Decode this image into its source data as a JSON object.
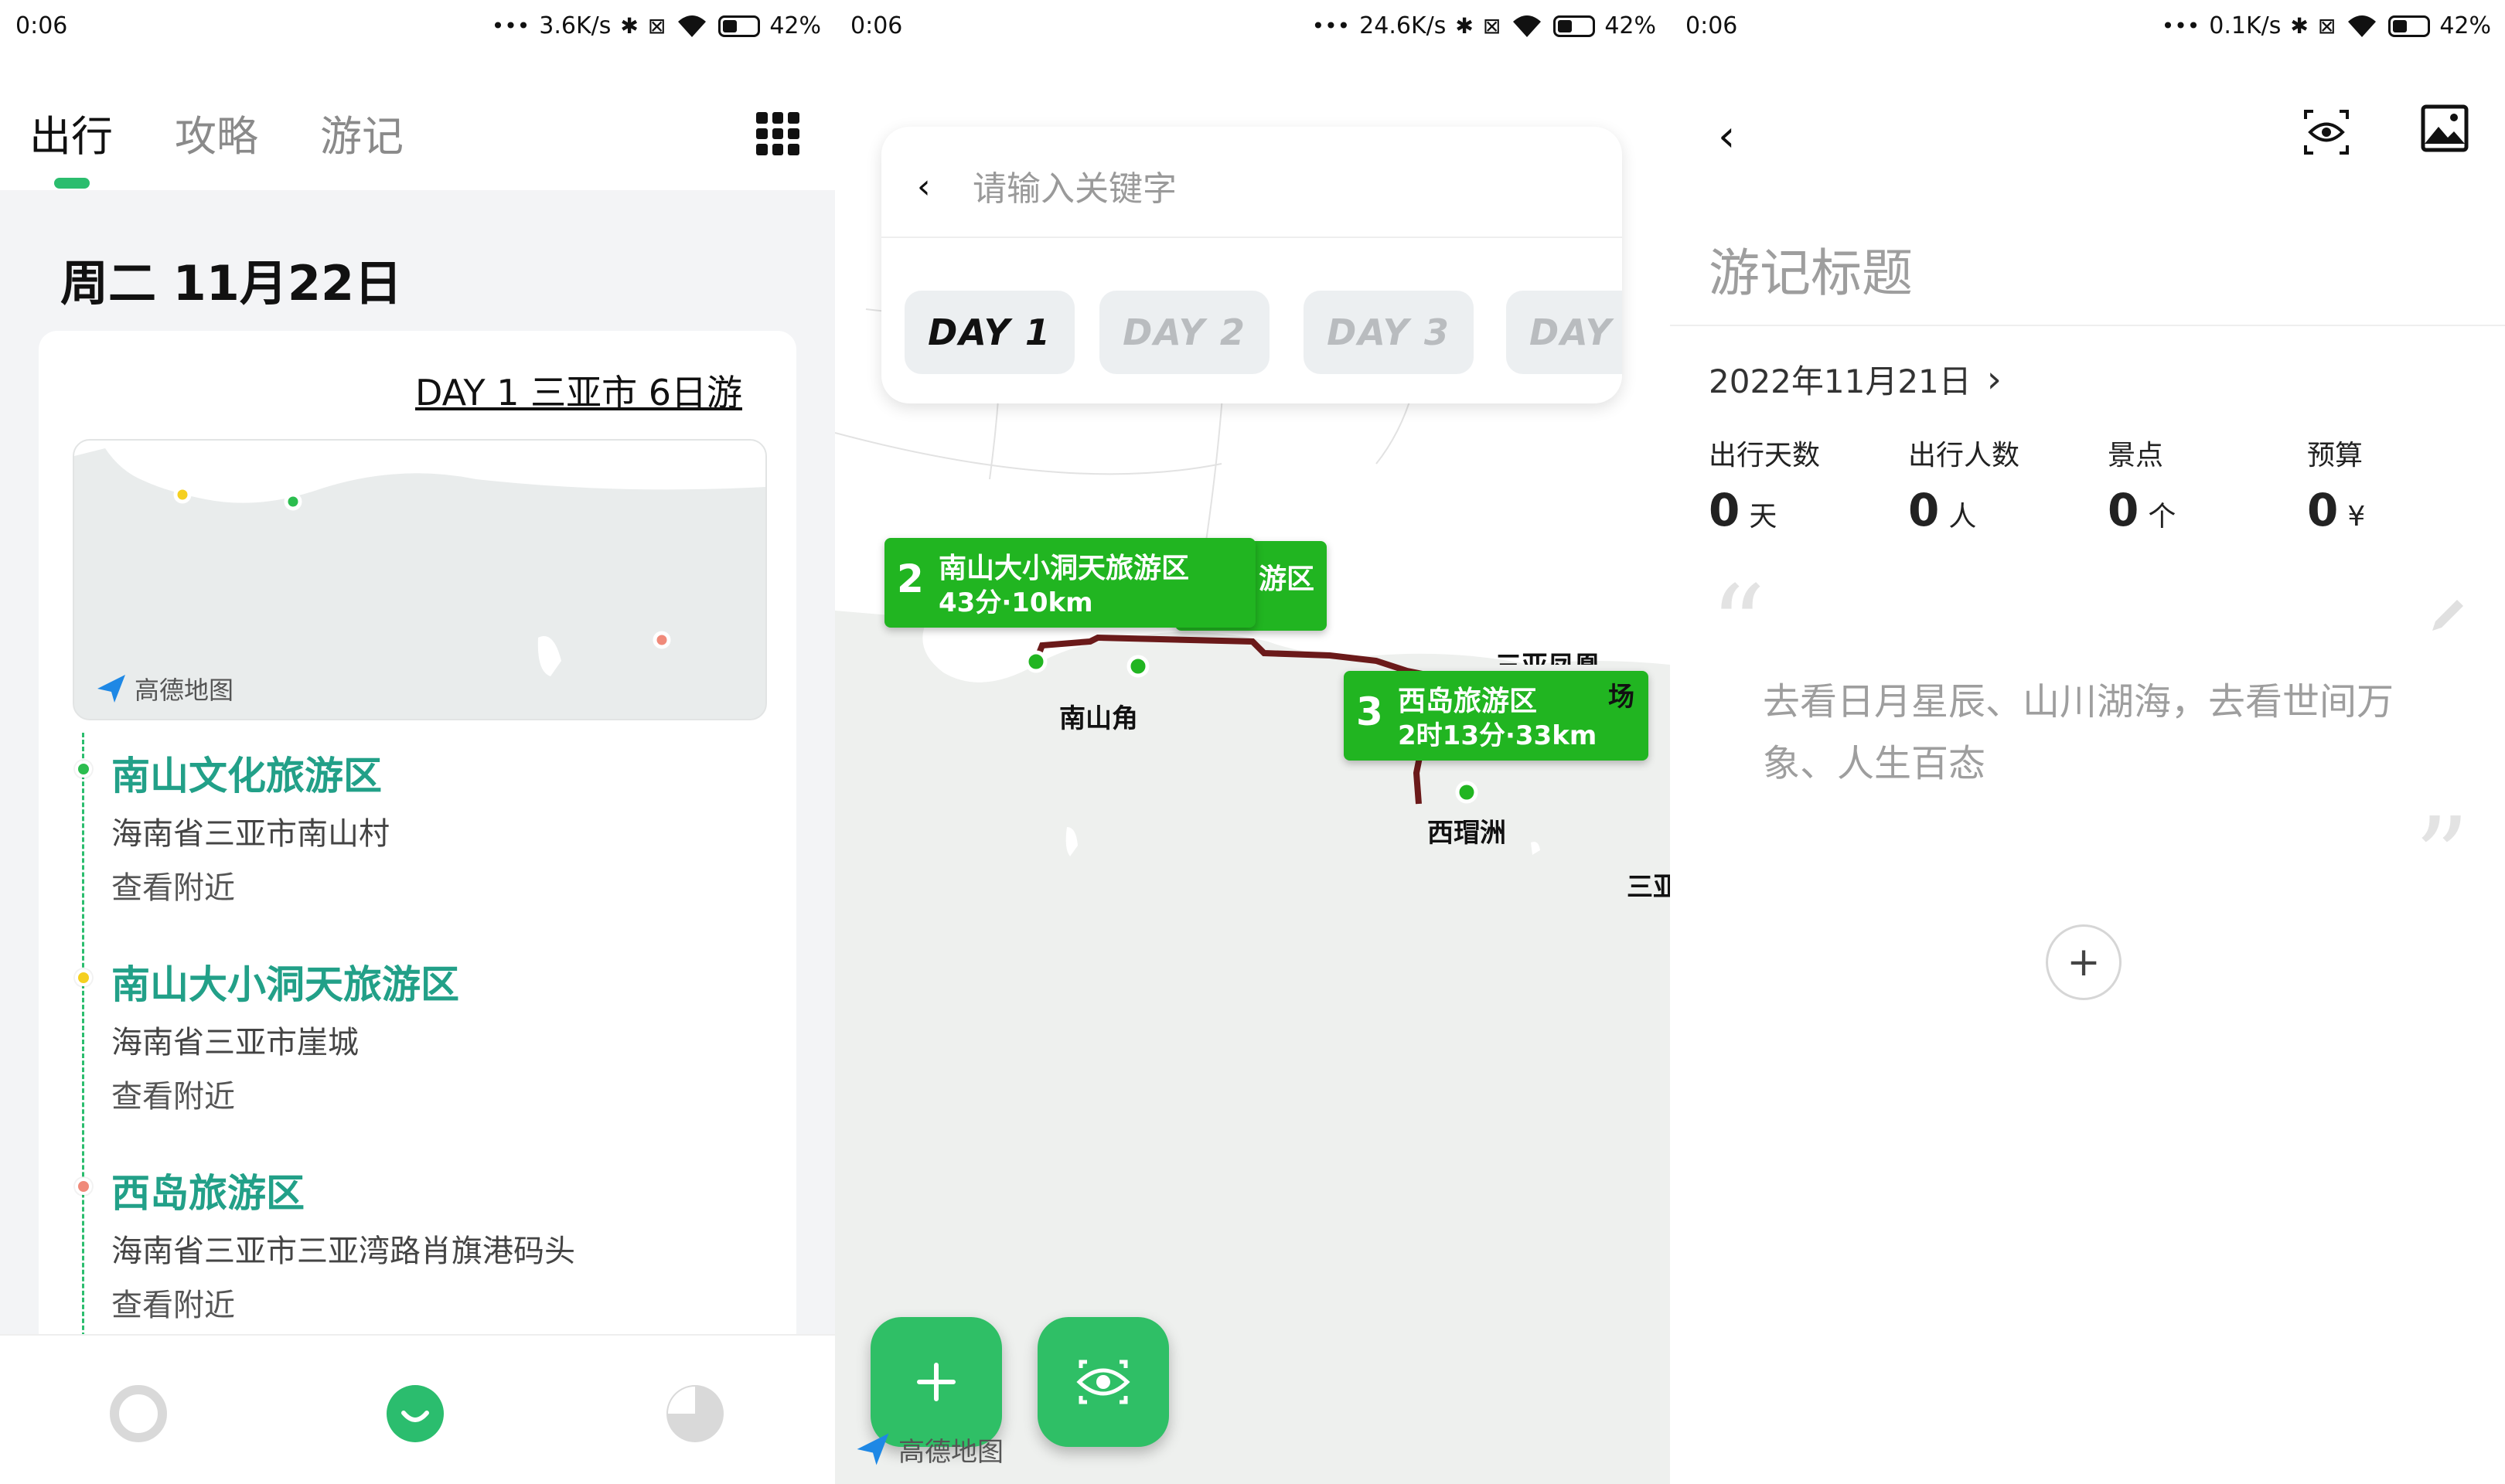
{
  "screens": [
    {
      "status": {
        "time": "0:06",
        "speed": "3.6K/s",
        "battery": "42%"
      },
      "tabs": [
        "出行",
        "攻略",
        "游记"
      ],
      "active_tab": "出行",
      "date_heading": "周二 11月22日",
      "trip_title": "DAY 1 三亚市 6日游",
      "map_brand": "高德地图",
      "stops": [
        {
          "name": "南山文化旅游区",
          "address": "海南省三亚市南山村",
          "action": "查看附近",
          "color": "#2bbd4e"
        },
        {
          "name": "南山大小洞天旅游区",
          "address": "海南省三亚市崖城",
          "action": "查看附近",
          "color": "#f5d020"
        },
        {
          "name": "西岛旅游区",
          "address": "海南省三亚市三亚湾路肖旗港码头",
          "action": "查看附近",
          "color": "#f08a7a"
        }
      ],
      "bottom_nav": [
        {
          "icon": "ring-icon",
          "active": false
        },
        {
          "icon": "smile-icon",
          "active": true
        },
        {
          "icon": "pie-icon",
          "active": false
        }
      ]
    },
    {
      "status": {
        "time": "0:06",
        "speed": "24.6K/s",
        "battery": "42%"
      },
      "search_placeholder": "请输入关键字",
      "days": [
        "DAY 1",
        "DAY 2",
        "DAY 3",
        "DAY"
      ],
      "selected_day": "DAY 1",
      "markers": [
        {
          "num": "2",
          "name": "南山大小洞天旅游区",
          "info": "43分·10km"
        },
        {
          "num": "3",
          "name": "西岛旅游区",
          "info": "2时13分·33km"
        }
      ],
      "hidden_marker_text": "游区",
      "places": [
        "南山角",
        "西瑁洲",
        "三亚凤凰",
        "场",
        "三亚"
      ],
      "map_brand": "高德地图",
      "fabs": [
        "plus-icon",
        "eye-icon"
      ]
    },
    {
      "status": {
        "time": "0:06",
        "speed": "0.1K/s",
        "battery": "42%"
      },
      "title_placeholder": "游记标题",
      "date": "2022年11月21日",
      "stats": [
        {
          "label": "出行天数",
          "value": "0",
          "unit": "天"
        },
        {
          "label": "出行人数",
          "value": "0",
          "unit": "人"
        },
        {
          "label": "景点",
          "value": "0",
          "unit": "个"
        },
        {
          "label": "预算",
          "value": "0",
          "unit": "¥"
        }
      ],
      "quote_placeholder": "去看日月星辰、山川湖海，去看世间万象、人生百态",
      "quote_open": "“",
      "quote_close": "”",
      "add_label": "+"
    }
  ]
}
